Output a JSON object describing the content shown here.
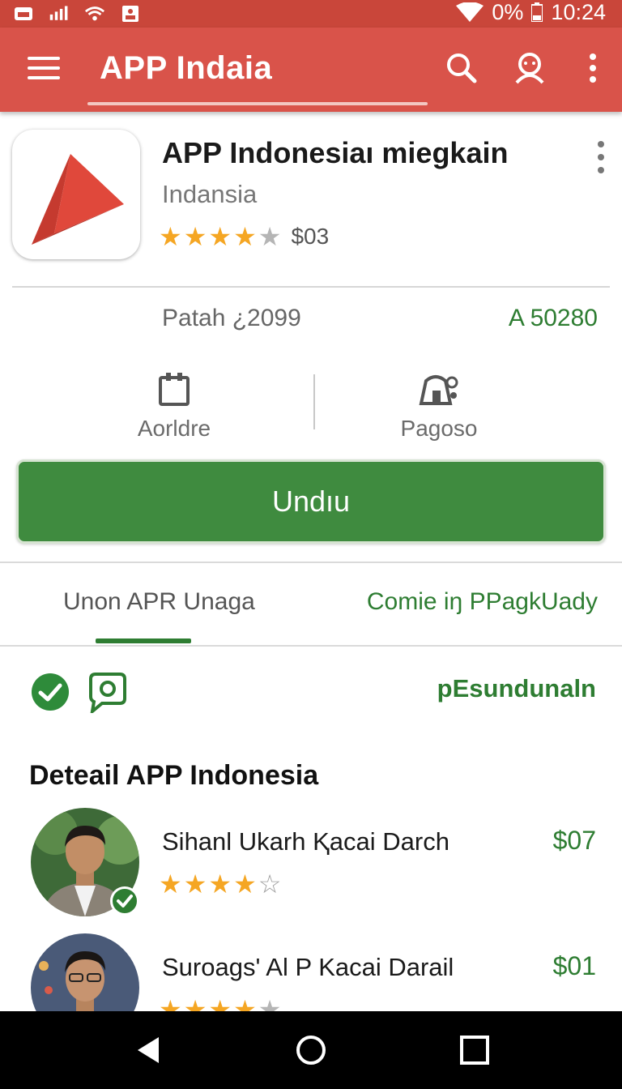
{
  "status_bar": {
    "battery_text": "0%",
    "time": "10:24",
    "icons": [
      "notification-icon",
      "signal-icon",
      "wifi-icon",
      "image-icon",
      "wifi-full-icon",
      "battery-icon"
    ]
  },
  "app_bar": {
    "title": "APP Indaia",
    "accent_color": "#d9534a",
    "icons": [
      "menu-icon",
      "search-icon",
      "account-icon",
      "more-vert-icon"
    ]
  },
  "app": {
    "name": "APP Indonesiaı miegkain",
    "developer": "Indansia",
    "rating_stars": 4,
    "rating_max": 5,
    "price_text": "$03"
  },
  "meta": {
    "left": "Patah ¿2099",
    "right": "A 50280"
  },
  "actions": [
    {
      "label": "Aorldre",
      "icon": "clipboard-icon"
    },
    {
      "label": "Pagoso",
      "icon": "badge-icon"
    }
  ],
  "install": {
    "label": "Undıu",
    "color": "#3f8b3f"
  },
  "tabs": [
    {
      "label": "Unon APR Unaga",
      "active": true
    },
    {
      "label": "Comie iŋ PPagkUady",
      "active": false
    }
  ],
  "info_row": {
    "link": "pEsundunaln"
  },
  "section": {
    "title": "Deteail APP Indonesia"
  },
  "reviews": [
    {
      "name": "Sihanl Ukarh Ⱪacai Darch",
      "amount": "$07",
      "stars": 4,
      "verified": true
    },
    {
      "name": "Suroags' Al P Kacai Darail",
      "amount": "$01",
      "stars": 4,
      "verified": false
    }
  ],
  "nav_bar": {
    "icons": [
      "back-icon",
      "home-icon",
      "recents-icon"
    ]
  }
}
